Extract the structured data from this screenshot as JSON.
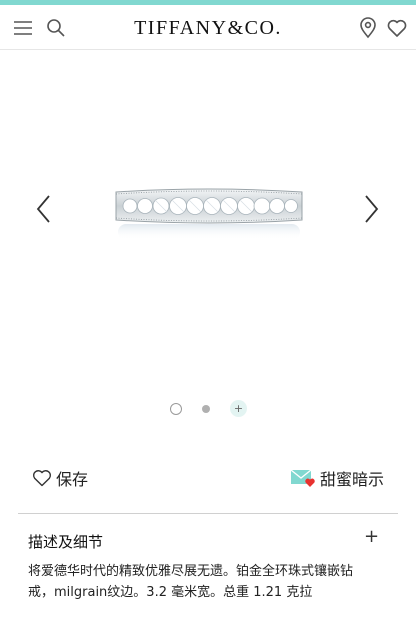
{
  "brand": {
    "logo_text": "TIFFANY&CO.",
    "accent_color": "#81d8d0"
  },
  "header": {
    "icons": [
      "menu-icon",
      "search-icon",
      "location-pin-icon",
      "heart-icon"
    ]
  },
  "gallery": {
    "prev_icon": "chevron-left-icon",
    "next_icon": "chevron-right-icon",
    "plus_dot_label": "+",
    "slide_count": 3,
    "active_slide": 1
  },
  "actions": {
    "save_label": "保存",
    "save_icon": "heart-outline-icon",
    "hint_label": "甜蜜暗示",
    "hint_icon": "envelope-heart-icon"
  },
  "details": {
    "title": "描述及细节",
    "toggle": "+",
    "description": "将爱德华时代的精致优雅尽展无遗。铂金全环珠式镶嵌钻戒，milgrain纹边。3.2 毫米宽。总重 1.21 克拉"
  }
}
